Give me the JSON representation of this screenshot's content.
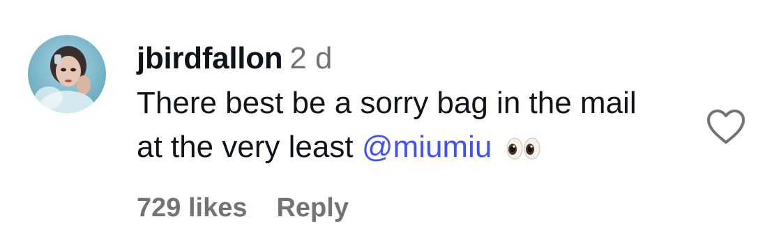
{
  "comment": {
    "username": "jbirdfallon",
    "timestamp": "2 d",
    "text_before": "There best be a sorry bag in the mail at the very least",
    "mention": "@miumiu",
    "emoji": "eyes-emoji",
    "likes": "729 likes",
    "reply_label": "Reply",
    "like_icon": "heart-outline-icon"
  },
  "colors": {
    "text": "#0f1419",
    "secondary": "#737373",
    "mention": "#4150f7"
  }
}
